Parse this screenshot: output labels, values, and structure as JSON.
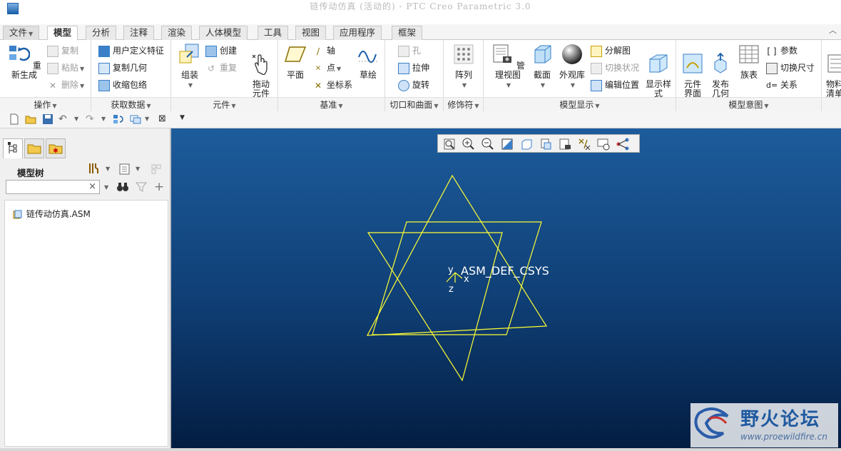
{
  "window": {
    "title": "链传动仿真 (活动的) - PTC Creo Parametric 3.0"
  },
  "tabs": [
    {
      "label": "文件",
      "dropdown": true
    },
    {
      "label": "模型",
      "active": true
    },
    {
      "label": "分析"
    },
    {
      "label": "注释"
    },
    {
      "label": "渲染"
    },
    {
      "label": "人体模型"
    },
    {
      "label": "工具"
    },
    {
      "label": "视图"
    },
    {
      "label": "应用程序"
    },
    {
      "label": "框架"
    }
  ],
  "ribbon": {
    "operations": {
      "label": "操作",
      "regenerate": "重新生成",
      "copy": "复制",
      "paste": "粘贴",
      "delete": "删除"
    },
    "get_data": {
      "label": "获取数据",
      "udf": "用户定义特征",
      "copy_geom": "复制几何",
      "shrinkwrap": "收缩包络"
    },
    "component": {
      "label": "元件",
      "assemble": "组装",
      "create": "创建",
      "repeat": "重复",
      "drag": "拖动\n元件"
    },
    "datum": {
      "label": "基准",
      "plane": "平面",
      "axis": "轴",
      "point": "点",
      "csys": "坐标系",
      "sketch": "草绘"
    },
    "cut_surface": {
      "label": "切口和曲面",
      "hole": "孔",
      "extrude": "拉伸",
      "revolve": "旋转"
    },
    "modifiers": {
      "label": "修饰符",
      "pattern": "阵列"
    },
    "model_display": {
      "label": "模型显示",
      "manage_views": "管理视图",
      "section": "截面",
      "appearance": "外观库",
      "explode": "分解图",
      "toggle_status": "切换状况",
      "edit_position": "编辑位置",
      "display_style": "显示样\n式"
    },
    "model_intent": {
      "label": "模型意图",
      "component_interface": "元件\n界面",
      "publish_geom": "发布\n几何",
      "family_table": "族表",
      "params": "参数",
      "switch_dims": "切换尺寸",
      "relations": "关系"
    },
    "bom": {
      "label": "物料\n清单"
    }
  },
  "model_tree": {
    "header": "模型树",
    "search_placeholder": "",
    "items": [
      {
        "label": "链传动仿真.ASM"
      }
    ]
  },
  "graphics": {
    "csys_label": "ASM_DEF_CSYS",
    "axis_y": "y",
    "axis_z": "z",
    "axis_x": "x",
    "datum_color": "#ffff33",
    "bg_top": "#1d5c9c",
    "bg_bottom": "#031d42"
  },
  "watermark": {
    "title": "野火论坛",
    "url": "www.proewildfire.cn"
  },
  "colors": {
    "accent": "#1a5fa8",
    "ribbon_bg": "#ffffff",
    "panel_bg": "#f0f0f0"
  }
}
